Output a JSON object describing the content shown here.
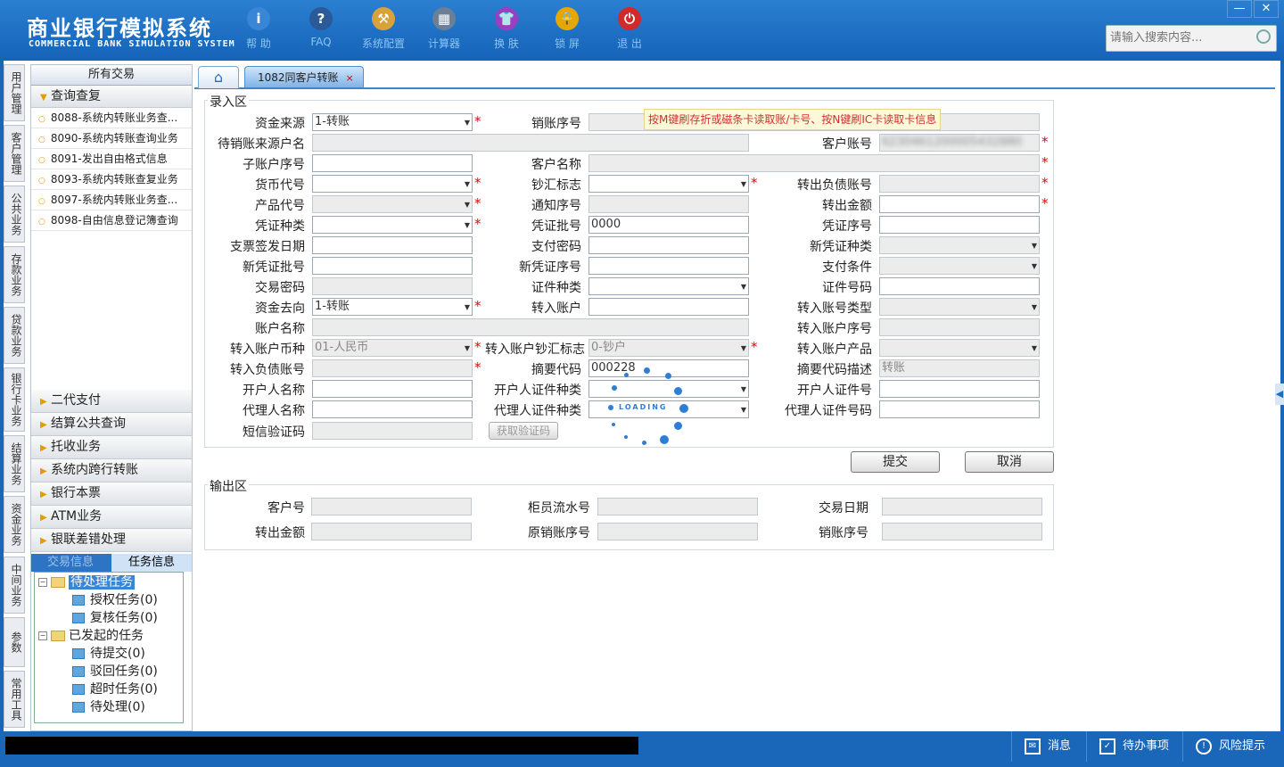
{
  "header": {
    "title_cn": "商业银行模拟系统",
    "title_en": "COMMERCIAL BANK SIMULATION SYSTEM",
    "toolbar": [
      {
        "label": "帮 助",
        "icon": "info-icon",
        "glyph": "i",
        "color": "#3a86d6"
      },
      {
        "label": "FAQ",
        "icon": "question-icon",
        "glyph": "?",
        "color": "#2a5a98"
      },
      {
        "label": "系统配置",
        "icon": "toolbox-icon",
        "glyph": "⚒",
        "color": "#d8a23a"
      },
      {
        "label": "计算器",
        "icon": "calculator-icon",
        "glyph": "▦",
        "color": "#6b7f97"
      },
      {
        "label": "换 肤",
        "icon": "shirt-icon",
        "glyph": "👕",
        "color": "#9a3fc0"
      },
      {
        "label": "锁 屏",
        "icon": "lock-icon",
        "glyph": "🔒",
        "color": "#e6a800"
      },
      {
        "label": "退 出",
        "icon": "power-icon",
        "glyph": "⏻",
        "color": "#d02a2a"
      }
    ],
    "search_placeholder": "请输入搜索内容...",
    "window_buttons": {
      "minimize": "—",
      "close": "✕"
    }
  },
  "vertical_tabs": [
    "用户管理",
    "客户管理",
    "公共业务",
    "存款业务",
    "贷款业务",
    "银行卡业务",
    "结算业务",
    "资金业务",
    "中间业务",
    "参数",
    "常用工具"
  ],
  "nav": {
    "header": "所有交易",
    "open_group": "查询查复",
    "items": [
      "8088-系统内转账业务查...",
      "8090-系统内转账查询业务",
      "8091-发出自由格式信息",
      "8093-系统内转账查复业务",
      "8097-系统内转账业务查...",
      "8098-自由信息登记簿查询"
    ],
    "groups": [
      "二代支付",
      "结算公共查询",
      "托收业务",
      "系统内跨行转账",
      "银行本票",
      "ATM业务",
      "银联差错处理"
    ],
    "info_tabs": [
      "交易信息",
      "任务信息"
    ],
    "tree": {
      "pending": "待处理任务",
      "pending_children": [
        "授权任务(0)",
        "复核任务(0)"
      ],
      "initiated": "已发起的任务",
      "initiated_children": [
        "待提交(0)",
        "驳回任务(0)",
        "超时任务(0)",
        "待处理(0)"
      ]
    }
  },
  "tabs": {
    "current": "1082同客户转账",
    "close": "×"
  },
  "input_section": {
    "legend": "录入区",
    "tip": "按M键刷存折或磁条卡读取账/卡号、按N键刷IC卡读取卡信息",
    "labels": {
      "fund_source": "资金来源",
      "cancel_seq": "销账序号",
      "pending_src_name": "待销账来源户名",
      "customer_acct": "客户账号",
      "sub_acct_seq": "子账户序号",
      "customer_name": "客户名称",
      "currency": "货币代号",
      "cash_flag": "钞汇标志",
      "out_liab_acct": "转出负债账号",
      "product": "产品代号",
      "notice_seq": "通知序号",
      "out_amount": "转出金额",
      "voucher_type": "凭证种类",
      "voucher_batch": "凭证批号",
      "voucher_seq": "凭证序号",
      "cheque_date": "支票签发日期",
      "pay_pwd": "支付密码",
      "new_voucher_type": "新凭证种类",
      "new_voucher_batch": "新凭证批号",
      "new_voucher_seq": "新凭证序号",
      "pay_cond": "支付条件",
      "trade_pwd": "交易密码",
      "id_type": "证件种类",
      "id_no": "证件号码",
      "fund_dest": "资金去向",
      "in_acct": "转入账户",
      "in_acct_type": "转入账号类型",
      "acct_name": "账户名称",
      "in_acct_seq": "转入账户序号",
      "in_currency": "转入账户币种",
      "in_cash_flag": "转入账户钞汇标志",
      "in_product": "转入账户产品",
      "in_liab_acct": "转入负债账号",
      "summary_code": "摘要代码",
      "summary_desc": "摘要代码描述",
      "open_name": "开户人名称",
      "open_id_type": "开户人证件种类",
      "open_id_no": "开户人证件号",
      "agent_name": "代理人名称",
      "agent_id_type": "代理人证件种类",
      "agent_id_no": "代理人证件号码",
      "sms_code": "短信验证码"
    },
    "values": {
      "fund_source": "1-转账",
      "customer_acct": "6230461200005432880",
      "voucher_batch": "0000",
      "fund_dest": "1-转账",
      "in_currency": "01-人民币",
      "in_cash_flag": "0-钞户",
      "summary_code": "000228",
      "summary_desc": "转账"
    },
    "get_code_btn": "获取验证码",
    "loading": "LOADING",
    "submit": "提交",
    "cancel": "取消"
  },
  "output_section": {
    "legend": "输出区",
    "labels": {
      "customer_no": "客户号",
      "teller_seq": "柜员流水号",
      "trade_date": "交易日期",
      "out_amount": "转出金额",
      "orig_cancel_seq": "原销账序号",
      "cancel_seq": "销账序号"
    }
  },
  "status_bar": {
    "msg": "消息",
    "todo": "待办事项",
    "risk": "风险提示"
  }
}
